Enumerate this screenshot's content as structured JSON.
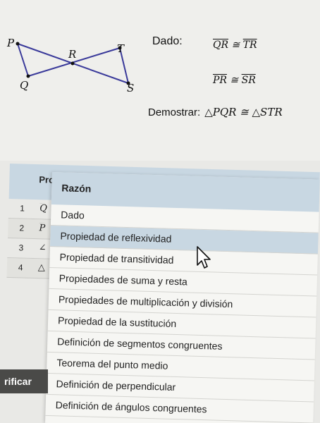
{
  "diagram": {
    "points": {
      "P": "P",
      "R": "R",
      "T": "T",
      "Q": "Q",
      "S": "S"
    }
  },
  "given": {
    "label": "Dado:",
    "statement1": {
      "left": "QR",
      "sym": "≅",
      "right": "TR"
    },
    "statement2": {
      "left": "PR",
      "sym": "≅",
      "right": "SR"
    }
  },
  "prove": {
    "label": "Demostrar:",
    "statement": "△PQR ≅ △STR"
  },
  "table": {
    "col_statement": "Pro",
    "rows": [
      {
        "num": "1",
        "stmt": "Q"
      },
      {
        "num": "2",
        "stmt": "P"
      },
      {
        "num": "3",
        "stmt": "∠"
      },
      {
        "num": "4",
        "stmt": "△"
      }
    ]
  },
  "reason_menu": {
    "header": "Razón",
    "items": [
      "Dado",
      "Propiedad de reflexividad",
      "Propiedad de transitividad",
      "Propiedades de suma y resta",
      "Propiedades de multiplicación y división",
      "Propiedad de la sustitución",
      "Definición de segmentos congruentes",
      "Teorema del punto medio",
      "Definición de perpendicular",
      "Definición de ángulos congruentes"
    ],
    "hovered_index": 1
  },
  "verify_button": "rificar"
}
